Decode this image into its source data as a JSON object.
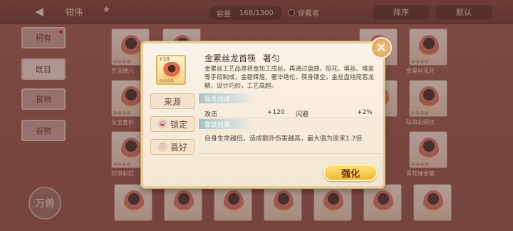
{
  "topbar": {
    "back_icon": "◀",
    "title": "钳伟",
    "crown_icon": "★",
    "capacity_label": "容量",
    "capacity_value": "168/1300",
    "wearer_label": "穿戴者",
    "sort_label": "降序",
    "default_label": "默认"
  },
  "sidebar": {
    "tabs": [
      {
        "label": "柯有"
      },
      {
        "label": "既目"
      },
      {
        "label": "良物"
      },
      {
        "label": "谷物"
      }
    ],
    "emblem_label": "万兽"
  },
  "grid": {
    "labels": [
      "百宝楼八",
      "东宝套价",
      "珐琅彩红",
      "金累丝花开",
      "珐琅彩绣纹",
      "青花缠金菊"
    ]
  },
  "popup": {
    "item_level": "+10",
    "item_rings": "◎◎◎◎",
    "buttons": {
      "source_label": "来源",
      "lock_label": "锁定",
      "like_label": "喜好"
    },
    "item_name": "金累丝龙首筷",
    "item_author": "著匀",
    "description": "金累丝工艺品是将金加工成丝，再通过盘曲、掐花、填丝、堆垒等手段制成，金碧辉煌，奢华绝伦。筷身镂空，金丝盘结宛若龙鳞，设计巧妙，工艺高超。",
    "attr_header": "属性加成",
    "stats": {
      "attack_label": "攻击",
      "attack_value": "+120",
      "dodge_label": "闪避",
      "dodge_value": "+2%"
    },
    "set_header": "套装效果",
    "set_desc": "自身生命越低，造成额外伤害越高，最大值为原来1.7倍",
    "enhance_label": "强化",
    "close_icon": "✕"
  }
}
